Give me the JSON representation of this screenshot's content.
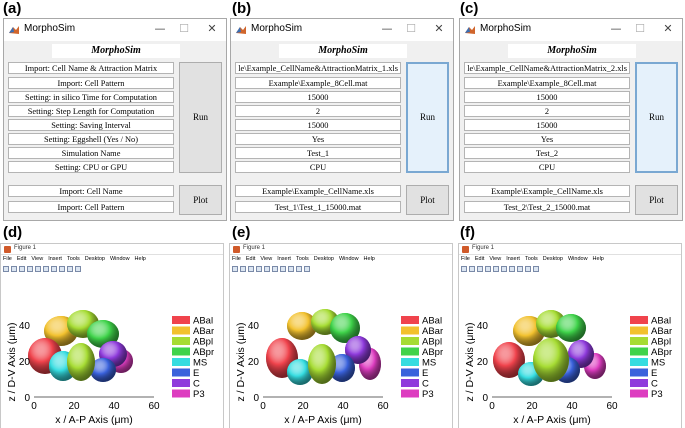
{
  "panel_labels": [
    "(a)",
    "(b)",
    "(c)",
    "(d)",
    "(e)",
    "(f)"
  ],
  "windows": [
    {
      "title": "MorphoSim",
      "app_name": "MorphoSim",
      "fields": [
        "Import: Cell Name & Attraction Matrix",
        "Import: Cell Pattern",
        "Setting: in silico Time for Computation",
        "Setting: Step Length for Computation",
        "Setting: Saving Interval",
        "Setting: Eggshell (Yes / No)",
        "Simulation Name",
        "Setting: CPU or GPU",
        "Import: Cell Name",
        "Import: Cell Pattern"
      ],
      "run_label": "Run",
      "plot_label": "Plot"
    },
    {
      "title": "MorphoSim",
      "app_name": "MorphoSim",
      "fields": [
        "le\\Example_CellName&AttractionMatrix_1.xls",
        "Example\\Example_8Cell.mat",
        "15000",
        "2",
        "15000",
        "Yes",
        "Test_1",
        "CPU",
        "Example\\Example_CellName.xls",
        "Test_1\\Test_1_15000.mat"
      ],
      "run_label": "Run",
      "plot_label": "Plot"
    },
    {
      "title": "MorphoSim",
      "app_name": "MorphoSim",
      "fields": [
        "le\\Example_CellName&AttractionMatrix_2.xls",
        "Example\\Example_8Cell.mat",
        "15000",
        "2",
        "15000",
        "Yes",
        "Test_2",
        "CPU",
        "Example\\Example_CellName.xls",
        "Test_2\\Test_2_15000.mat"
      ],
      "run_label": "Run",
      "plot_label": "Plot"
    }
  ],
  "figures": [
    {
      "title": "Figure 1"
    },
    {
      "title": "Figure 1"
    },
    {
      "title": "Figure 1"
    }
  ],
  "figure_menu": [
    "File",
    "Edit",
    "View",
    "Insert",
    "Tools",
    "Desktop",
    "Window",
    "Help"
  ],
  "axes": {
    "xlabel": "x / A-P Axis (μm)",
    "ylabel": "z / D-V Axis (μm)",
    "xticks": [
      "0",
      "20",
      "40",
      "60"
    ],
    "yticks": [
      "0",
      "20",
      "40"
    ]
  },
  "legend": [
    {
      "name": "ABal",
      "color": "#f0434c"
    },
    {
      "name": "ABar",
      "color": "#f2c12e"
    },
    {
      "name": "ABpl",
      "color": "#a6dc33"
    },
    {
      "name": "ABpr",
      "color": "#3fd34a"
    },
    {
      "name": "MS",
      "color": "#35dce0"
    },
    {
      "name": "E",
      "color": "#3a62dc"
    },
    {
      "name": "C",
      "color": "#8f3bdc"
    },
    {
      "name": "P3",
      "color": "#dd3dc0"
    }
  ]
}
